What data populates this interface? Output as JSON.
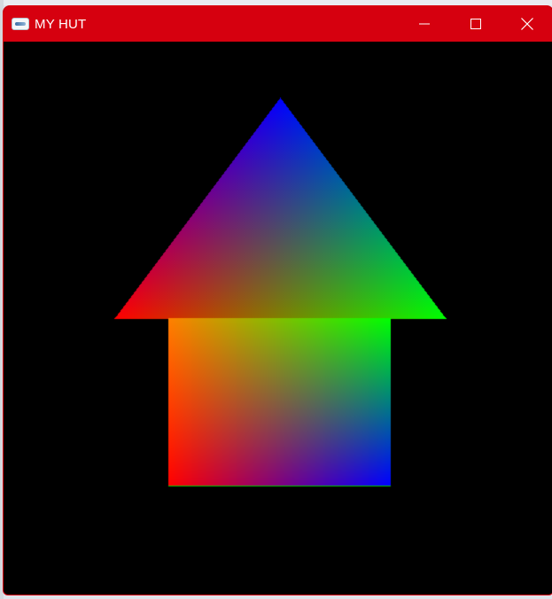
{
  "window": {
    "title": "MY HUT",
    "controls": {
      "minimize": "minimize",
      "maximize": "maximize",
      "close": "close"
    }
  },
  "scene": {
    "background": "#000000",
    "roof_colors": {
      "left": "#ff0000",
      "top": "#0000ff",
      "right": "#00ff00"
    },
    "wall_colors": {
      "top_left": "#ff8000",
      "top_right": "#00ff00",
      "bottom_left": "#ff0000",
      "bottom_right": "#0000ff"
    }
  },
  "colors": {
    "titlebar": "#d6000f",
    "title_text": "#ffffff"
  }
}
